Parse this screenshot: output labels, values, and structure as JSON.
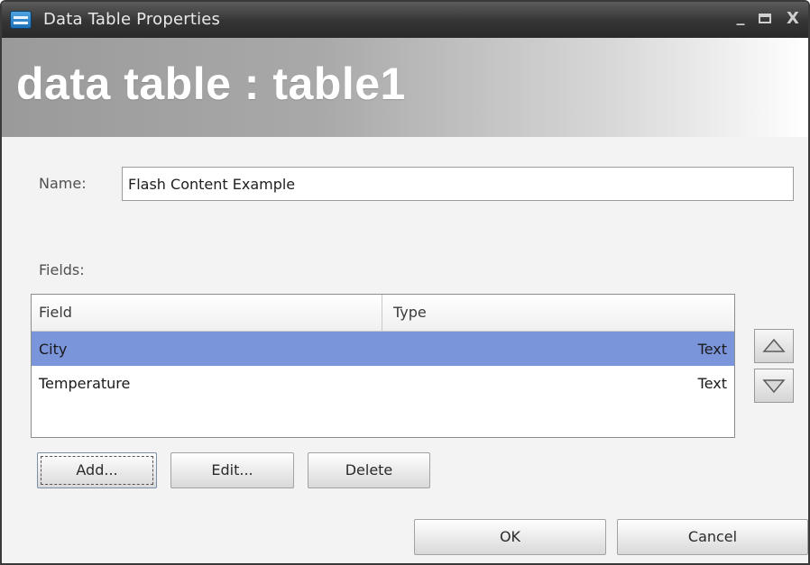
{
  "window": {
    "title": "Data Table Properties",
    "minimize_glyph": "_",
    "close_glyph": "X"
  },
  "banner": {
    "title": "data table : table1"
  },
  "name": {
    "label": "Name:",
    "value": "Flash Content Example"
  },
  "fields": {
    "label": "Fields:",
    "columns": [
      "Field",
      "Type"
    ],
    "rows": [
      {
        "field": "City",
        "type": "Text",
        "selected": true
      },
      {
        "field": "Temperature",
        "type": "Text",
        "selected": false
      }
    ]
  },
  "buttons": {
    "add": "Add...",
    "edit": "Edit...",
    "delete": "Delete",
    "ok": "OK",
    "cancel": "Cancel"
  },
  "colors": {
    "selected_row": "#7b95db",
    "titlebar": "#343434"
  },
  "icons": {
    "app": "data-table-app-icon",
    "move_up": "arrow-up-icon",
    "move_down": "arrow-down-icon"
  }
}
